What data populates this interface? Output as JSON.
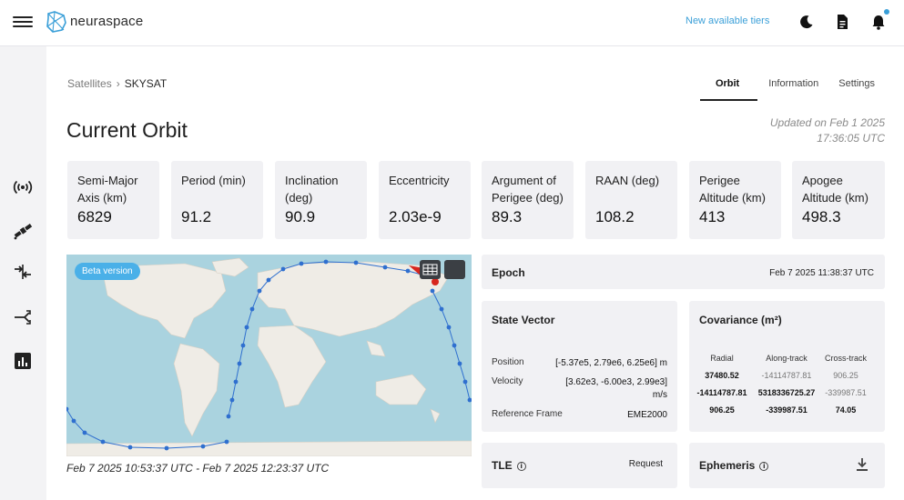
{
  "brand": {
    "name": "neuraspace"
  },
  "header": {
    "tiers_link": "New available tiers",
    "icons": [
      "menu-icon",
      "moon-icon",
      "document-icon",
      "bell-icon"
    ]
  },
  "sidebar": {
    "icons": [
      "antenna-icon",
      "satellite-icon",
      "arrows-merge-icon",
      "share-arrows-icon",
      "bar-chart-icon"
    ]
  },
  "breadcrumb": {
    "parent": "Satellites",
    "separator": "›",
    "current": "SKYSAT"
  },
  "tabs": [
    {
      "label": "Orbit",
      "active": true
    },
    {
      "label": "Information",
      "active": false
    },
    {
      "label": "Settings",
      "active": false
    }
  ],
  "page_title": "Current Orbit",
  "updated": {
    "line1": "Updated on Feb 1 2025",
    "line2": "17:36:05 UTC"
  },
  "metrics": [
    {
      "label": "Semi-Major Axis (km)",
      "value": "6829"
    },
    {
      "label": "Period (min)",
      "value": "91.2"
    },
    {
      "label": "Inclination (deg)",
      "value": "90.9"
    },
    {
      "label": "Eccentricity",
      "value": "2.03e-9"
    },
    {
      "label": "Argument of Perigee (deg)",
      "value": "89.3"
    },
    {
      "label": "RAAN (deg)",
      "value": "108.2"
    },
    {
      "label": "Perigee Altitude (km)",
      "value": "413"
    },
    {
      "label": "Apogee Altitude (km)",
      "value": "498.3"
    }
  ],
  "map": {
    "beta_label": "Beta version",
    "time_range": "Feb 7 2025 10:53:37 UTC - Feb 7 2025 12:23:37 UTC",
    "colors": {
      "ocean": "#aad3df",
      "land": "#efece6",
      "track": "#2f6fcf",
      "current_position": "#d7261e"
    }
  },
  "epoch": {
    "title": "Epoch",
    "value": "Feb 7 2025 11:38:37 UTC"
  },
  "state_vector": {
    "title": "State Vector",
    "position": {
      "label": "Position",
      "value": "[-5.37e5, 2.79e6, 6.25e6] m"
    },
    "velocity": {
      "label": "Velocity",
      "value1": "[3.62e3, -6.00e3, 2.99e3]",
      "value2": "m/s"
    },
    "reference_frame": {
      "label": "Reference Frame",
      "value": "EME2000"
    }
  },
  "covariance": {
    "title": "Covariance (m²)",
    "headers": [
      "Radial",
      "Along-track",
      "Cross-track"
    ],
    "rows": [
      [
        "37480.52",
        "-14114787.81",
        "906.25"
      ],
      [
        "-14114787.81",
        "5318336725.27",
        "-339987.51"
      ],
      [
        "906.25",
        "-339987.51",
        "74.05"
      ]
    ]
  },
  "tle": {
    "title": "TLE",
    "info_glyph": "i",
    "action": "Request"
  },
  "ephemeris": {
    "title": "Ephemeris",
    "info_glyph": "i"
  }
}
